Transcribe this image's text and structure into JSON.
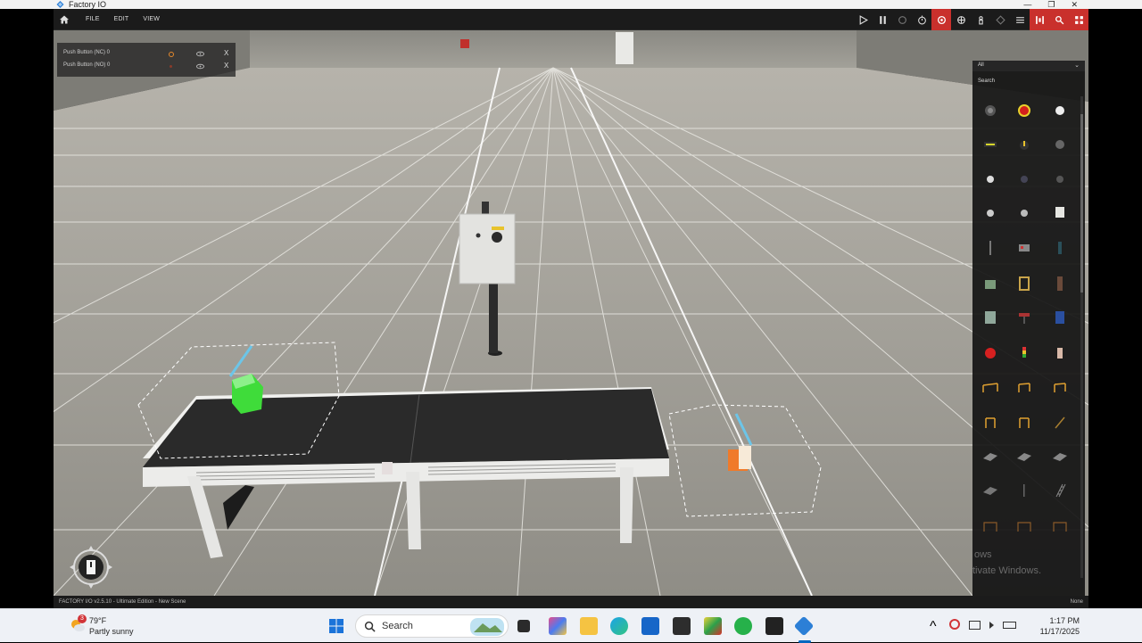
{
  "window": {
    "title": "Factory IO",
    "controls": [
      "—",
      "❐",
      "✕"
    ]
  },
  "menubar": {
    "items": [
      "FILE",
      "EDIT",
      "VIEW"
    ]
  },
  "toolbar": {
    "icons": [
      "play-icon",
      "pause-icon",
      "restart-icon",
      "stopwatch-icon",
      "camera-orbit-icon",
      "camera-fly-icon",
      "camera-first-person-icon",
      "sensor-view-icon",
      "cube-select-icon",
      "list-icon",
      "drivers-icon",
      "tags-icon",
      "palette-icon"
    ]
  },
  "tags": [
    {
      "name": "Push Button (NC) 0",
      "state_color": "#e6892c",
      "close": "X"
    },
    {
      "name": "Push Button (NO) 0",
      "state_color": "#8a3b2a",
      "close": "X"
    }
  ],
  "palette": {
    "filter": "All",
    "search_label": "Search",
    "watermark_line1": "ows",
    "watermark_line2": "tivate Windows."
  },
  "statusbar": {
    "version": "FACTORY I/O v2.5.10 - Ultimate Edition - New Scene",
    "selection": "None"
  },
  "taskbar": {
    "weather_badge": "3",
    "weather_temp": "79°F",
    "weather_desc": "Partly sunny",
    "search_placeholder": "Search",
    "time": "1:17 PM",
    "date": "11/17/2025"
  }
}
